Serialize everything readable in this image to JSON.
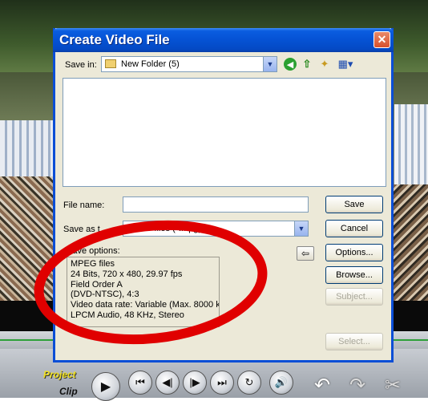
{
  "player": {
    "project_label": "Project",
    "clip_label": "Clip"
  },
  "dialog": {
    "title": "Create Video File",
    "close_glyph": "✕",
    "save_in_label": "Save in:",
    "save_in_value": "New Folder (5)",
    "file_name_label": "File name:",
    "file_name_value": "",
    "save_as_label": "Save as t",
    "save_as_value": "MPEG files (*.mpg)",
    "save_options_label": "Save options:",
    "save_options_lines": [
      "MPEG files",
      "24 Bits, 720 x 480, 29.97 fps",
      "Field Order A",
      "(DVD-NTSC),  4:3",
      "Video data rate: Variable (Max.  8000 k",
      "LPCM Audio, 48 KHz, Stereo"
    ],
    "buttons": {
      "save": "Save",
      "cancel": "Cancel",
      "options": "Options...",
      "browse": "Browse...",
      "subject": "Subject...",
      "select": "Select..."
    },
    "toolbar_icons": [
      "back-icon",
      "up-folder-icon",
      "new-folder-icon",
      "views-menu-icon"
    ]
  },
  "annotation": {
    "color": "#e00000"
  },
  "colors": {
    "titlebar": "#0552d4",
    "dialog_bg": "#ece9d8",
    "close_button": "#d8502c",
    "timeline_line": "#2ea03a"
  }
}
